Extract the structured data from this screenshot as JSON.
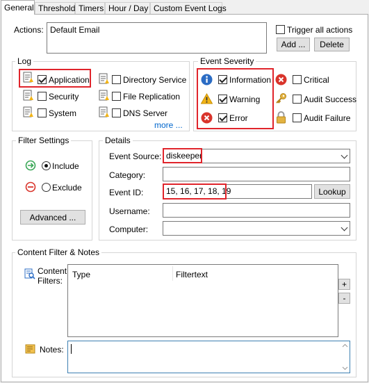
{
  "tabs": [
    "General",
    "Threshold",
    "Timers",
    "Hour / Day",
    "Custom Event Logs"
  ],
  "actions": {
    "label": "Actions:",
    "items": [
      "Default Email"
    ],
    "trigger_all_label": "Trigger all actions",
    "add_label": "Add ...",
    "delete_label": "Delete"
  },
  "log": {
    "title": "Log",
    "items": [
      {
        "label": "Application",
        "checked": true
      },
      {
        "label": "Security",
        "checked": false
      },
      {
        "label": "System",
        "checked": false
      },
      {
        "label": "Directory Service",
        "checked": false
      },
      {
        "label": "File Replication",
        "checked": false
      },
      {
        "label": "DNS Server",
        "checked": false
      }
    ],
    "more_label": "more ..."
  },
  "severity": {
    "title": "Event Severity",
    "items": [
      {
        "label": "Information",
        "checked": true,
        "icon": "info-icon"
      },
      {
        "label": "Warning",
        "checked": true,
        "icon": "warning-icon"
      },
      {
        "label": "Error",
        "checked": true,
        "icon": "error-icon"
      },
      {
        "label": "Critical",
        "checked": false,
        "icon": "critical-icon"
      },
      {
        "label": "Audit Success",
        "checked": false,
        "icon": "key-icon"
      },
      {
        "label": "Audit Failure",
        "checked": false,
        "icon": "lock-icon"
      }
    ]
  },
  "filter_settings": {
    "title": "Filter Settings",
    "include_label": "Include",
    "exclude_label": "Exclude",
    "selected": "Include",
    "advanced_label": "Advanced ..."
  },
  "details": {
    "title": "Details",
    "event_source_label": "Event Source:",
    "event_source_value": "diskeeper",
    "category_label": "Category:",
    "category_value": "",
    "event_id_label": "Event ID:",
    "event_id_value": "15, 16, 17, 18, 19",
    "lookup_label": "Lookup",
    "username_label": "Username:",
    "username_value": "",
    "computer_label": "Computer:",
    "computer_value": ""
  },
  "content": {
    "title": "Content Filter & Notes",
    "filters_label": "Content\nFilters:",
    "columns": [
      "Type",
      "Filtertext"
    ],
    "add_label": "+",
    "remove_label": "-",
    "notes_label": "Notes:",
    "notes_value": ""
  },
  "colors": {
    "highlight": "#e0242b",
    "info": "#2b6cc4",
    "warning": "#f2b417",
    "error": "#d9342b",
    "link": "#0066cc"
  }
}
